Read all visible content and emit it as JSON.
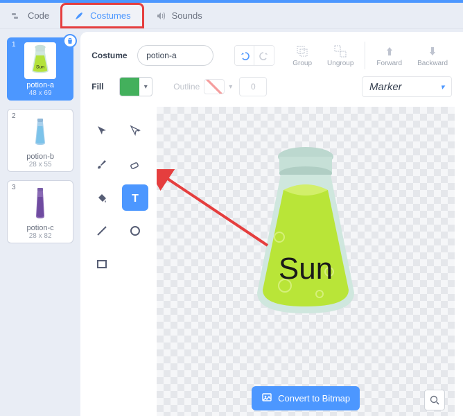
{
  "tabs": {
    "code": "Code",
    "costumes": "Costumes",
    "sounds": "Sounds"
  },
  "sidebar": {
    "items": [
      {
        "num": "1",
        "name": "potion-a",
        "size": "48 x 69"
      },
      {
        "num": "2",
        "name": "potion-b",
        "size": "28 x 55"
      },
      {
        "num": "3",
        "name": "potion-c",
        "size": "28 x 82"
      }
    ]
  },
  "header": {
    "costume_label": "Costume",
    "costume_name": "potion-a",
    "group": "Group",
    "ungroup": "Ungroup",
    "forward": "Forward",
    "backward": "Backward"
  },
  "style": {
    "fill_label": "Fill",
    "fill_color": "#43b05c",
    "outline_label": "Outline",
    "outline_value": "0",
    "font": "Marker"
  },
  "canvas": {
    "potion_text": "Sun"
  },
  "footer": {
    "convert": "Convert to Bitmap"
  }
}
